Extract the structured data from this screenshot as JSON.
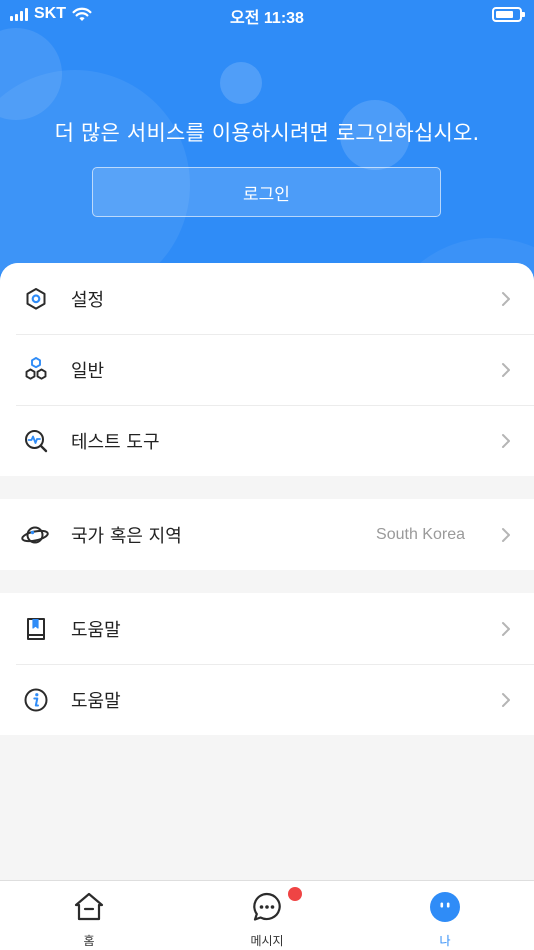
{
  "status_bar": {
    "carrier": "SKT",
    "time": "오전 11:38"
  },
  "header": {
    "promo_text": "더 많은 서비스를 이용하시려면 로그인하십시오.",
    "login_label": "로그인",
    "color": "#2f8cf7"
  },
  "menu": {
    "group1": [
      {
        "label": "설정",
        "icon": "settings-hex-icon"
      },
      {
        "label": "일반",
        "icon": "general-cubes-icon"
      },
      {
        "label": "테스트 도구",
        "icon": "test-tool-icon"
      }
    ],
    "group2": [
      {
        "label": "국가 혹은 지역",
        "value": "South Korea",
        "icon": "planet-icon"
      }
    ],
    "group3": [
      {
        "label": "도움말",
        "icon": "book-icon"
      },
      {
        "label": "도움말",
        "icon": "info-icon"
      }
    ]
  },
  "tabbar": {
    "tabs": [
      {
        "label": "홈",
        "icon": "home-icon"
      },
      {
        "label": "메시지",
        "icon": "message-icon",
        "badge": true
      },
      {
        "label": "나",
        "icon": "profile-icon",
        "active": true
      }
    ],
    "active_color": "#2f8cf7",
    "badge_color": "#ef4444"
  }
}
